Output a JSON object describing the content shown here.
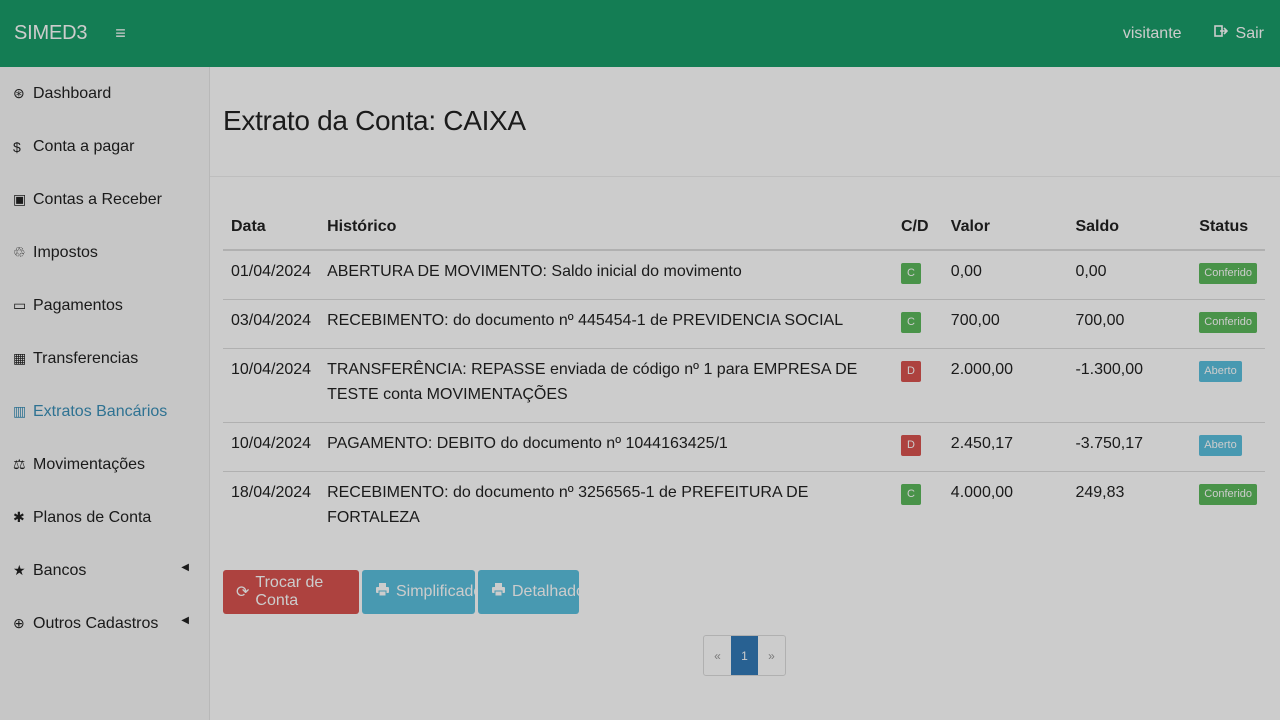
{
  "header": {
    "brand": "SIMED3",
    "user": "visitante",
    "logout_label": "Sair"
  },
  "sidebar": {
    "items": [
      {
        "label": "Dashboard",
        "icon": "dashboard-icon",
        "glyph": "⊛"
      },
      {
        "label": "Conta a pagar",
        "icon": "dollar-icon",
        "glyph": "$"
      },
      {
        "label": "Contas a Receber",
        "icon": "money-icon",
        "glyph": "▣"
      },
      {
        "label": "Impostos",
        "icon": "recycle-icon",
        "glyph": "♲"
      },
      {
        "label": "Pagamentos",
        "icon": "credit-card-icon",
        "glyph": "▭"
      },
      {
        "label": "Transferencias",
        "icon": "calculator-icon",
        "glyph": "▦"
      },
      {
        "label": "Extratos Bancários",
        "icon": "bar-chart-icon",
        "glyph": "▥"
      },
      {
        "label": "Movimentações",
        "icon": "balance-scale-icon",
        "glyph": "⚖"
      },
      {
        "label": "Planos de Conta",
        "icon": "asterisk-icon",
        "glyph": "✱"
      },
      {
        "label": "Bancos",
        "icon": "star-icon",
        "glyph": "★"
      },
      {
        "label": "Outros Cadastros",
        "icon": "plus-circle-icon",
        "glyph": "⊕"
      }
    ],
    "active_index": 6
  },
  "page": {
    "title": "Extrato da Conta: CAIXA"
  },
  "table": {
    "headers": [
      "Data",
      "Histórico",
      "C/D",
      "Valor",
      "Saldo",
      "Status"
    ],
    "rows": [
      {
        "data": "01/04/2024",
        "historico": "ABERTURA DE MOVIMENTO: Saldo inicial do movimento",
        "cd": "C",
        "valor": "0,00",
        "saldo": "0,00",
        "status": "Conferido"
      },
      {
        "data": "03/04/2024",
        "historico": "RECEBIMENTO: do documento nº 445454-1 de PREVIDENCIA SOCIAL",
        "cd": "C",
        "valor": "700,00",
        "saldo": "700,00",
        "status": "Conferido"
      },
      {
        "data": "10/04/2024",
        "historico": "TRANSFERÊNCIA: REPASSE enviada de código nº 1 para EMPRESA DE TESTE conta MOVIMENTAÇÕES",
        "cd": "D",
        "valor": "2.000,00",
        "saldo": "-1.300,00",
        "status": "Aberto"
      },
      {
        "data": "10/04/2024",
        "historico": "PAGAMENTO: DEBITO do documento nº 1044163425/1",
        "cd": "D",
        "valor": "2.450,17",
        "saldo": "-3.750,17",
        "status": "Aberto"
      },
      {
        "data": "18/04/2024",
        "historico": "RECEBIMENTO: do documento nº 3256565-1 de PREFEITURA DE FORTALEZA",
        "cd": "C",
        "valor": "4.000,00",
        "saldo": "249,83",
        "status": "Conferido"
      }
    ]
  },
  "actions": {
    "trocar": "Trocar de Conta",
    "simplificado": "Simplificado",
    "detalhado": "Detalhado"
  },
  "pagination": {
    "prev": "«",
    "current": "1",
    "next": "»"
  },
  "colors": {
    "topbar": "#1a9d6a",
    "active_link": "#3a8fb7",
    "danger": "#d9534f",
    "success": "#5cb85c",
    "info": "#5bc0de",
    "primary": "#337ab7"
  }
}
